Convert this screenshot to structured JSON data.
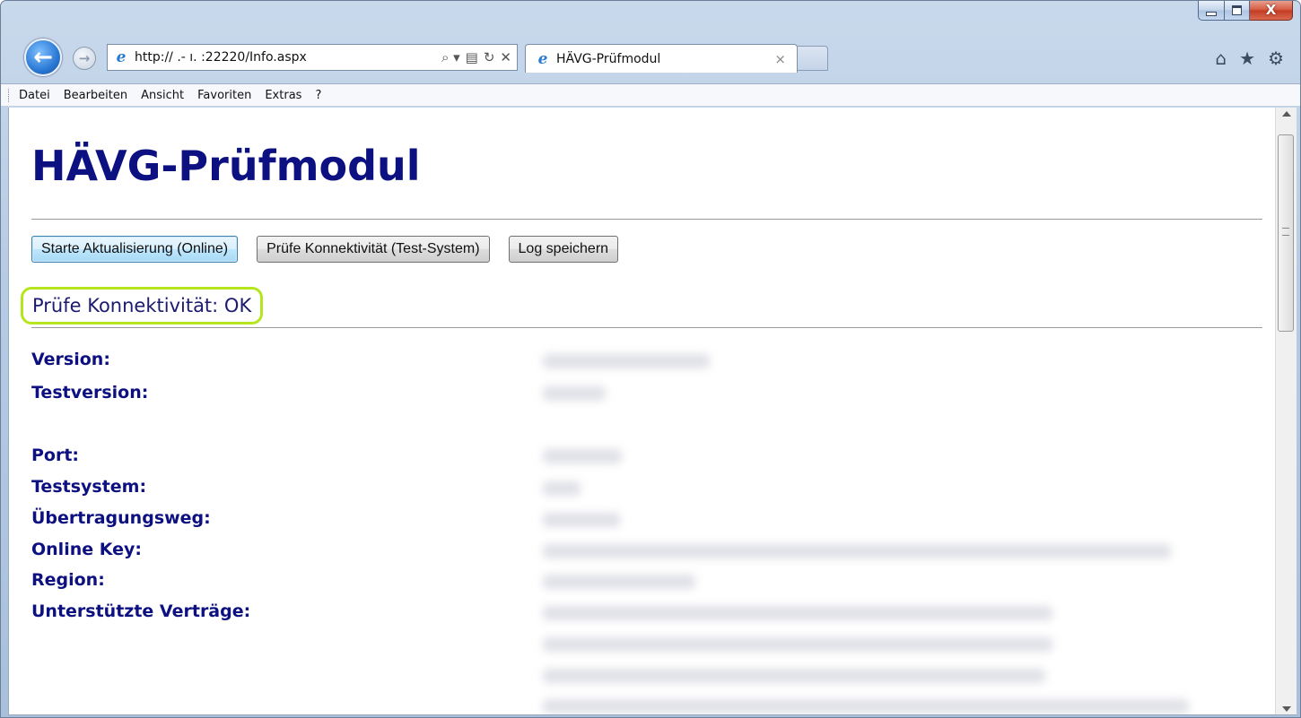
{
  "window": {
    "minimize_icon": "minimize-icon",
    "maximize_icon": "maximize-icon",
    "close_icon": "close-icon",
    "close_glyph": "X"
  },
  "browser": {
    "url": "http://  .-  ı. :22220/Info.aspx",
    "search_glyph": "⌕ ▾",
    "compat_glyph": "▤",
    "refresh_glyph": "↻",
    "stop_glyph": "✕",
    "tab_title": "HÄVG-Prüfmodul",
    "tab_close_glyph": "×",
    "home_glyph": "⌂",
    "favorites_glyph": "★",
    "tools_glyph": "⚙"
  },
  "menu": {
    "items": [
      "Datei",
      "Bearbeiten",
      "Ansicht",
      "Favoriten",
      "Extras",
      "?"
    ]
  },
  "page": {
    "title": "HÄVG-Prüfmodul",
    "buttons": {
      "update": "Starte Aktualisierung (Online)",
      "check": "Prüfe Konnektivität (Test-System)",
      "log": "Log speichern"
    },
    "status": "Prüfe Konnektivität: OK",
    "status_highlight_color": "#b5e61d",
    "labels": {
      "version": "Version:",
      "testversion": "Testversion:",
      "port": "Port:",
      "testsystem": "Testsystem:",
      "transfer": "Übertragungsweg:",
      "online_key": "Online Key:",
      "region": "Region:",
      "contracts": "Unterstützte Verträge:"
    }
  },
  "colors": {
    "heading": "#0c1080",
    "label": "#0c1080",
    "highlight": "#b5e61d"
  }
}
